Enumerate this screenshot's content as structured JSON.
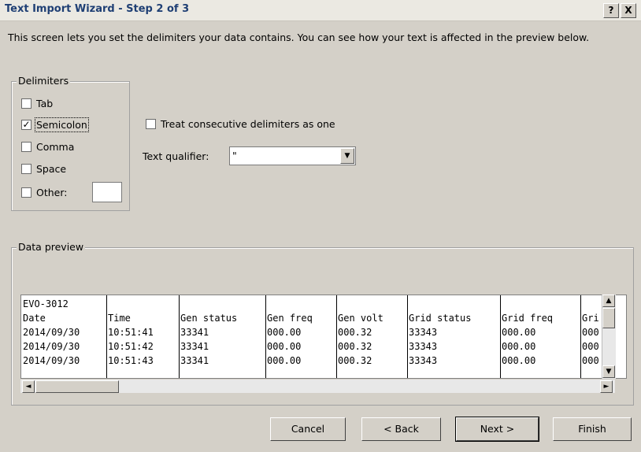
{
  "window": {
    "title": "Text Import Wizard - Step 2 of 3",
    "help_label": "?",
    "close_label": "X"
  },
  "intro": "This screen lets you set the delimiters your data contains.  You can see how your text is affected in the preview below.",
  "delimiters": {
    "legend": "Delimiters",
    "items": [
      {
        "label": "Tab",
        "checked": false
      },
      {
        "label": "Semicolon",
        "checked": true
      },
      {
        "label": "Comma",
        "checked": false
      },
      {
        "label": "Space",
        "checked": false
      },
      {
        "label": "Other:",
        "checked": false
      }
    ],
    "other_value": ""
  },
  "consecutive": {
    "label": "Treat consecutive delimiters as one",
    "checked": false
  },
  "text_qualifier": {
    "label": "Text qualifier:",
    "value": "\""
  },
  "preview": {
    "legend": "Data preview",
    "rows": [
      [
        "EVO-3012",
        "",
        "",
        "",
        "",
        "",
        "",
        ""
      ],
      [
        "Date",
        "Time",
        "Gen status",
        "Gen freq",
        "Gen volt",
        "Grid status",
        "Grid freq",
        "Gri"
      ],
      [
        "2014/09/30",
        "10:51:41",
        "33341",
        "000.00",
        "000.32",
        "33343",
        "000.00",
        "000"
      ],
      [
        "2014/09/30",
        "10:51:42",
        "33341",
        "000.00",
        "000.32",
        "33343",
        "000.00",
        "000"
      ],
      [
        "2014/09/30",
        "10:51:43",
        "33341",
        "000.00",
        "000.32",
        "33343",
        "000.00",
        "000"
      ]
    ]
  },
  "buttons": {
    "cancel": "Cancel",
    "back": "< Back",
    "next": "Next >",
    "finish": "Finish"
  }
}
